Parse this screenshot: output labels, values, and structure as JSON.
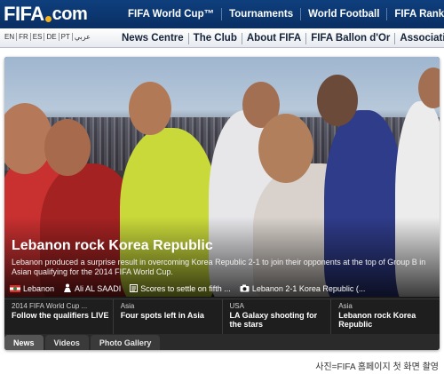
{
  "header": {
    "logo_text": "FIFA",
    "logo_suffix": "com",
    "nav": [
      "FIFA World Cup™",
      "Tournaments",
      "World Football",
      "FIFA Ranking"
    ]
  },
  "languages": [
    "EN",
    "FR",
    "ES",
    "DE",
    "PT",
    "عربي"
  ],
  "subnav": [
    "News Centre",
    "The Club",
    "About FIFA",
    "FIFA Ballon d'Or",
    "Associations"
  ],
  "feature": {
    "headline": "Lebanon rock Korea Republic",
    "summary": "Lebanon produced a surprise result in overcoming Korea Republic 2-1 to join their opponents at the top of Group B in Asian qualifying for the 2014 FIFA World Cup.",
    "related": [
      {
        "icon": "lebanon-flag-icon",
        "label": "Lebanon"
      },
      {
        "icon": "player-icon",
        "label": "Ali AL SAADI"
      },
      {
        "icon": "article-icon",
        "label": "Scores to settle on fifth ..."
      },
      {
        "icon": "camera-icon",
        "label": "Lebanon 2-1 Korea Republic (..."
      }
    ]
  },
  "stories": [
    {
      "category": "2014 FIFA World Cup ...",
      "title": "Follow the qualifiers LIVE"
    },
    {
      "category": "Asia",
      "title": "Four spots left in Asia"
    },
    {
      "category": "USA",
      "title": "LA Galaxy shooting for the stars"
    },
    {
      "category": "Asia",
      "title": "Lebanon rock Korea Republic"
    }
  ],
  "tabs": [
    "News",
    "Videos",
    "Photo Gallery"
  ],
  "caption": "사진=FIFA 홈페이지 첫 화면 촬영",
  "colors": {
    "header_bg": "#0e3f7d",
    "accent": "#f3b21b",
    "card_bg": "#1b1b1b"
  }
}
